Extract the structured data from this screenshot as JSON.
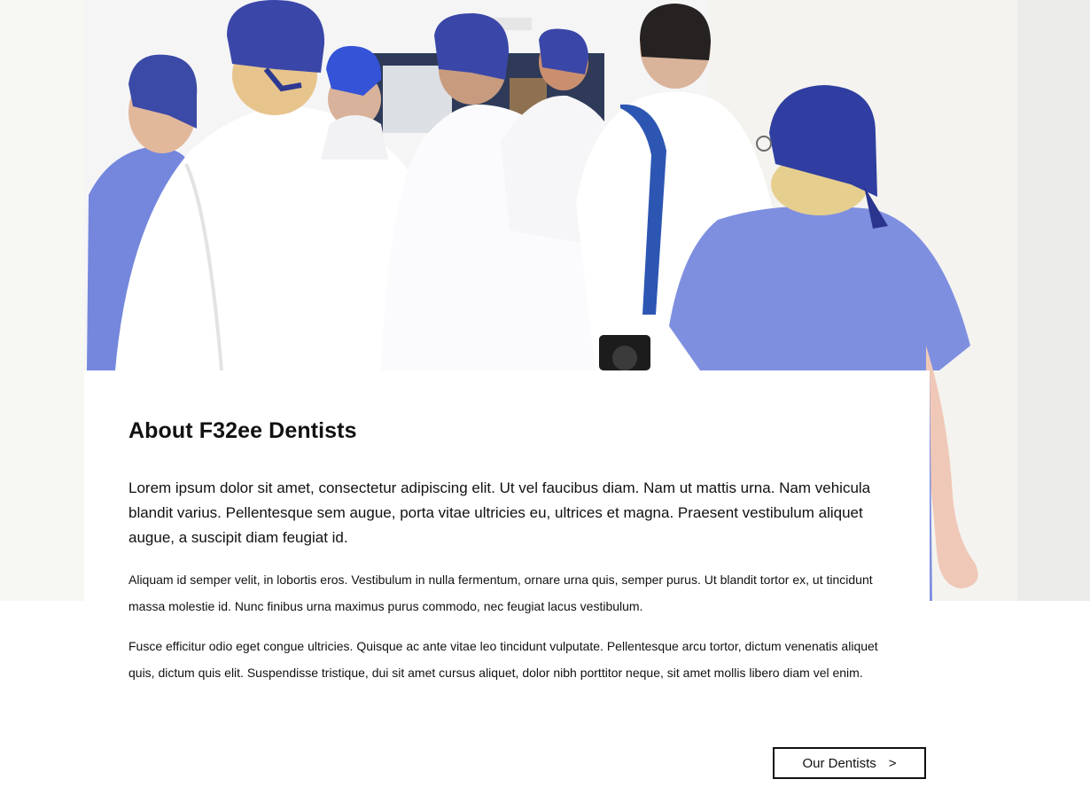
{
  "hero": {
    "image_description_icon": "medical-staff-photo"
  },
  "about": {
    "title": "About F32ee Dentists",
    "lead": "Lorem ipsum dolor sit amet, consectetur adipiscing elit. Ut vel faucibus diam. Nam ut mattis urna. Nam vehicula blandit varius. Pellentesque sem augue, porta vitae ultricies eu, ultrices et magna. Praesent vestibulum aliquet augue, a suscipit diam feugiat id.",
    "paragraph_1": "Aliquam id semper velit, in lobortis eros. Vestibulum in nulla fermentum, ornare urna quis, semper purus. Ut blandit tortor ex, ut tincidunt massa molestie id. Nunc finibus urna maximus purus commodo, nec feugiat lacus vestibulum.",
    "paragraph_2": "Fusce efficitur odio eget congue ultricies. Quisque ac ante vitae leo tincidunt vulputate. Pellentesque arcu tortor, dictum venenatis aliquet quis, dictum quis elit. Suspendisse tristique, dui sit amet cursus aliquet, dolor nibh porttitor neque, sit amet mollis libero diam vel enim.",
    "button_label": "Our Dentists",
    "button_arrow": ">"
  },
  "colors": {
    "scrub_blue": "#7f8fe0",
    "cap_blue": "#3a47a8",
    "coat_white": "#f4f4f4",
    "text": "#111111"
  }
}
